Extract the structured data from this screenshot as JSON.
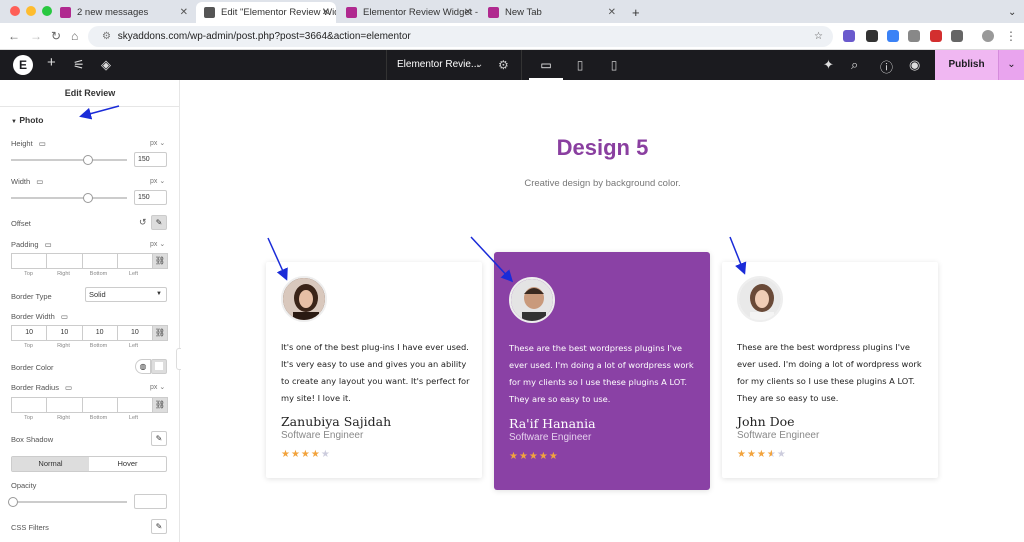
{
  "browser": {
    "tabs": [
      {
        "title": "2 new messages",
        "fav_color": "#b0298f"
      },
      {
        "title": "Edit \"Elementor Review Widg",
        "fav_color": "#555555"
      },
      {
        "title": "Elementor Review Widget - S",
        "fav_color": "#b0298f"
      },
      {
        "title": "New Tab",
        "fav_color": "#b0298f"
      }
    ],
    "url": "skyaddons.com/wp-admin/post.php?post=3664&action=elementor"
  },
  "topbar": {
    "logo": "E",
    "doc_title": "Elementor Revie...",
    "publish_label": "Publish"
  },
  "panel": {
    "title": "Edit Review",
    "section": "Photo",
    "height_label": "Height",
    "height_unit": "px",
    "height_value": "150",
    "height_level": 0.66,
    "width_label": "Width",
    "width_unit": "px",
    "width_value": "150",
    "width_level": 0.66,
    "offset_label": "Offset",
    "padding_label": "Padding",
    "padding_unit": "px",
    "dims": [
      "Top",
      "Right",
      "Bottom",
      "Left"
    ],
    "border_type_label": "Border Type",
    "border_type_value": "Solid",
    "border_width_label": "Border Width",
    "border_width_values": [
      "10",
      "10",
      "10",
      "10"
    ],
    "border_color_label": "Border Color",
    "border_radius_label": "Border Radius",
    "border_radius_unit": "px",
    "box_shadow_label": "Box Shadow",
    "tab_normal": "Normal",
    "tab_hover": "Hover",
    "opacity_label": "Opacity",
    "css_filters_label": "CSS Filters"
  },
  "canvas": {
    "heading": "Design 5",
    "subheading": "Creative design by background color.",
    "heading_color": "#8a3fa0",
    "cards": [
      {
        "text": "It's one of the best plug-ins I have ever used. It's very easy to use and gives you an ability to create any layout you want. It's perfect for my site! I love it.",
        "name": "Zanubiya Sajidah",
        "role": "Software Engineer",
        "rating": 4,
        "stars": "★★★★★"
      },
      {
        "text": "These are the best wordpress plugins I've ever used. I'm doing a lot of wordpress work for my clients so I use these plugins A LOT. They are so easy to use.",
        "name": "Ra'if Hanania",
        "role": "Software Engineer",
        "rating": 5,
        "stars": "★★★★★",
        "background": "#8a41a5"
      },
      {
        "text": "These are the best wordpress plugins I've ever used. I'm doing a lot of wordpress work for my clients so I use these plugins A LOT. They are so easy to use.",
        "name": "John Doe",
        "role": "Software Engineer",
        "rating": 3.5,
        "stars": "★★★★★"
      }
    ]
  }
}
